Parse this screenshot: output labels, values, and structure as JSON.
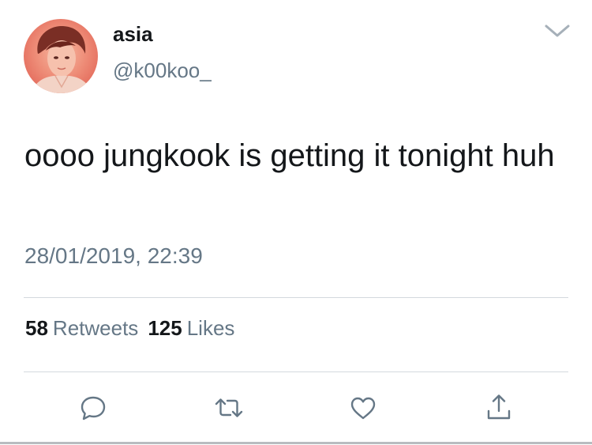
{
  "user": {
    "display_name": "asia",
    "handle": "@k00koo_"
  },
  "tweet": {
    "text": "oooo jungkook is getting it tonight huh",
    "timestamp": "28/01/2019, 22:39"
  },
  "stats": {
    "retweets_count": "58",
    "retweets_label": "Retweets",
    "likes_count": "125",
    "likes_label": "Likes"
  },
  "icons": {
    "menu": "chevron-down-icon",
    "reply": "reply-icon",
    "retweet": "retweet-icon",
    "like": "heart-icon",
    "share": "share-icon"
  },
  "colors": {
    "primary_text": "#14171a",
    "secondary_text": "#657786",
    "divider": "#d3d9de",
    "icon": "#657786",
    "avatar_tint": "#ee8d78"
  }
}
